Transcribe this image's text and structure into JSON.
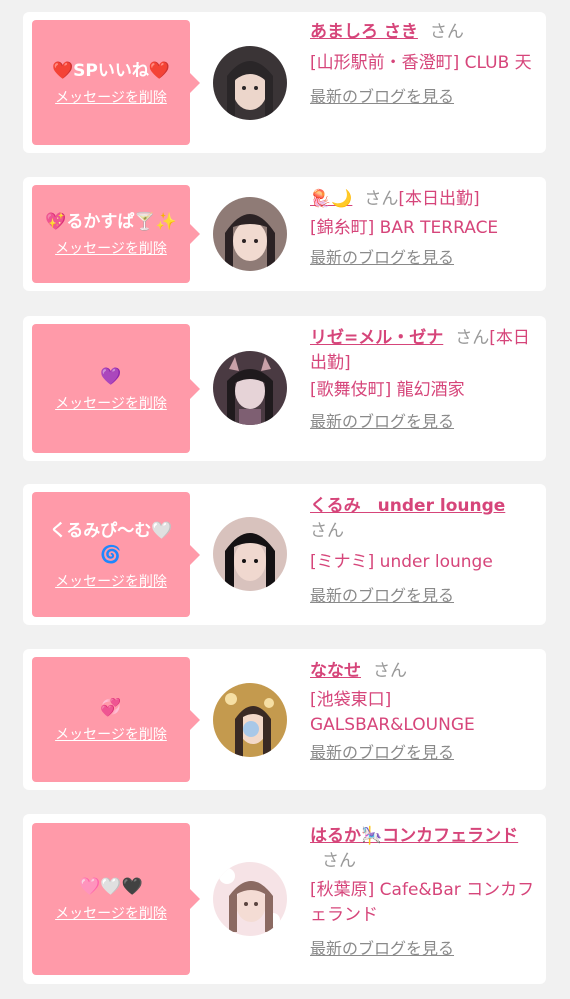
{
  "favorites": [
    {
      "message": "❤️SPいいね❤️",
      "delete_label": "メッセージを削除",
      "name": "あましろ さき",
      "honorific": "さん",
      "status": "",
      "shop": "[山形駅前・香澄町] CLUB 天",
      "blog_link": "最新のブログを見る",
      "avatar_colors": [
        "#2d2a2e",
        "#e7d2c6"
      ]
    },
    {
      "message": "💖るかすぱ🍸✨",
      "delete_label": "メッセージを削除",
      "name": "🪼🌙",
      "honorific": "さん",
      "status": "[本日出勤]",
      "shop": "[錦糸町] BAR TERRACE",
      "blog_link": "最新のブログを見る",
      "avatar_colors": [
        "#2b2224",
        "#ead3c9"
      ]
    },
    {
      "message": "💜",
      "delete_label": "メッセージを削除",
      "name": "リゼ=メル・ゼナ",
      "honorific": "さん",
      "status": "[本日出勤]",
      "shop": "[歌舞伎町] 龍幻酒家",
      "blog_link": "最新のブログを見る",
      "avatar_colors": [
        "#3a2f36",
        "#d9c6cc"
      ]
    },
    {
      "message": "くるみぴ〜む🤍🌀",
      "delete_label": "メッセージを削除",
      "name": "くるみ　under lounge",
      "honorific": "さん",
      "status": "",
      "shop": "[ミナミ] under lounge",
      "blog_link": "最新のブログを見る",
      "avatar_colors": [
        "#1d1a1c",
        "#eacfc8"
      ]
    },
    {
      "message": "💞",
      "delete_label": "メッセージを削除",
      "name": "ななせ",
      "honorific": "さん",
      "status": "",
      "shop": "[池袋東口] GALSBAR&LOUNGE",
      "blog_link": "最新のブログを見る",
      "avatar_colors": [
        "#b88a3e",
        "#f1d7a3"
      ]
    },
    {
      "message": "🩷🤍🖤",
      "delete_label": "メッセージを削除",
      "name": "はるか🎠コンカフェランド",
      "honorific": "さん",
      "status": "",
      "shop": "[秋葉原] Cafe&Bar コンカフェランド",
      "blog_link": "最新のブログを見る",
      "avatar_colors": [
        "#f3d8dc",
        "#ffffff"
      ]
    }
  ]
}
